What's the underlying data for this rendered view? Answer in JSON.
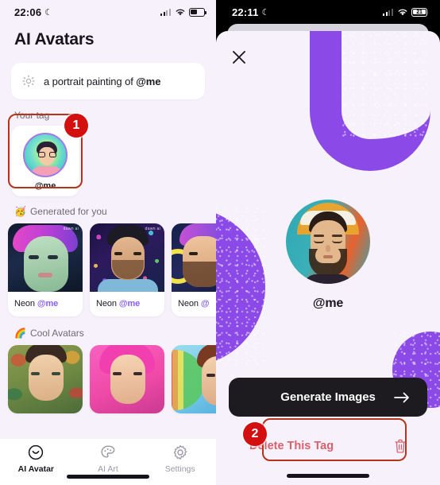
{
  "left": {
    "status_bar": {
      "time": "22:06",
      "moon_icon": "crescent-moon-icon",
      "signal_icon": "cellular-signal-icon",
      "wifi_icon": "wifi-icon",
      "battery_icon": "battery-icon"
    },
    "title": "AI Avatars",
    "prompt": {
      "icon": "sparkle-gear-icon",
      "value_prefix": "a portrait painting of ",
      "value_tag": "@me",
      "placeholder": "a portrait painting of @me"
    },
    "your_tag": {
      "label": "Your tag",
      "name": "@me"
    },
    "generated": {
      "emoji": "🥳",
      "label": "Generated for you",
      "cards": [
        {
          "caption_prefix": "Neon ",
          "caption_tag": "@me",
          "watermark": "dawn ai"
        },
        {
          "caption_prefix": "Neon ",
          "caption_tag": "@me",
          "watermark": "dawn ai"
        },
        {
          "caption_prefix": "Neon ",
          "caption_tag": "@",
          "watermark": ""
        }
      ]
    },
    "cool": {
      "emoji": "🌈",
      "label": "Cool Avatars",
      "cards": [
        {
          "caption": ""
        },
        {
          "caption": ""
        },
        {
          "caption": ""
        }
      ]
    },
    "tabs": [
      {
        "label": "AI Avatar",
        "icon": "smiley-face-icon",
        "active": true
      },
      {
        "label": "AI Art",
        "icon": "palette-icon",
        "active": false
      },
      {
        "label": "Settings",
        "icon": "gear-icon",
        "active": false
      }
    ]
  },
  "right": {
    "status_bar": {
      "time": "22:11",
      "moon_icon": "crescent-moon-icon",
      "signal_icon": "cellular-signal-icon",
      "wifi_icon": "wifi-icon",
      "battery_level": "21"
    },
    "close_icon": "close-x-icon",
    "tag_name": "@me",
    "primary_button": {
      "label": "Generate Images",
      "icon": "arrow-right-icon"
    },
    "secondary_button": {
      "label": "Delete This Tag",
      "icon": "trash-icon"
    }
  },
  "annotations": [
    {
      "id": "1",
      "number": "1",
      "target": "your-tag-card"
    },
    {
      "id": "2",
      "number": "2",
      "target": "delete-this-tag-button"
    }
  ],
  "colors": {
    "accent_purple": "#8b4ae8",
    "tag_purple": "#8a5cf0",
    "surface": "#f6f1fa",
    "dark": "#1d1b20",
    "danger": "#d9616b",
    "annotation_red": "#d40f0f",
    "annotation_border": "#b4351c"
  }
}
